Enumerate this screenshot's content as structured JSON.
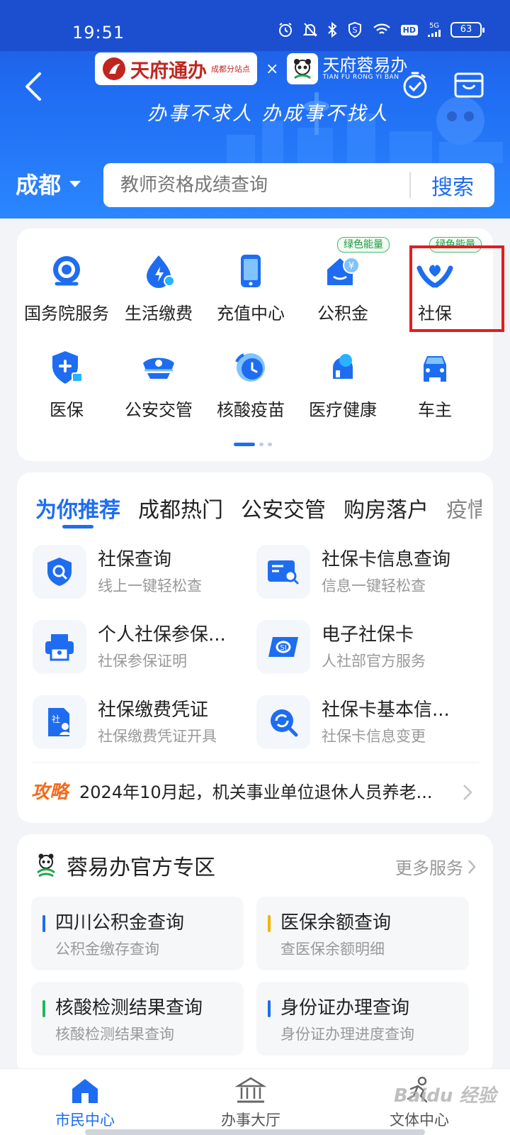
{
  "status_bar": {
    "time": "19:51",
    "signal": "5G",
    "hd": "HD",
    "battery": "63"
  },
  "header": {
    "brand_name": "天府通办",
    "brand_sub": "成都分站点",
    "separator": "×",
    "partner_name": "天府蓉易办",
    "partner_en": "TIAN FU RONG YI BAN",
    "slogan": "办事不求人 办成事不找人"
  },
  "location": {
    "city": "成都"
  },
  "search": {
    "placeholder": "教师资格成绩查询",
    "button_label": "搜索"
  },
  "grid": {
    "items": [
      {
        "label": "国务院服务",
        "icon": "state-council-icon"
      },
      {
        "label": "生活缴费",
        "icon": "utility-payment-icon"
      },
      {
        "label": "充值中心",
        "icon": "recharge-icon"
      },
      {
        "label": "公积金",
        "icon": "housing-fund-icon",
        "badge": "绿色能量"
      },
      {
        "label": "社保",
        "icon": "social-security-icon",
        "badge": "绿色能量",
        "highlighted": true
      },
      {
        "label": "医保",
        "icon": "medical-insurance-icon"
      },
      {
        "label": "公安交管",
        "icon": "police-cap-icon"
      },
      {
        "label": "核酸疫苗",
        "icon": "vaccine-clock-icon"
      },
      {
        "label": "医疗健康",
        "icon": "health-icon"
      },
      {
        "label": "车主",
        "icon": "car-icon"
      }
    ],
    "page": 1,
    "page_count": 3
  },
  "recommend": {
    "tabs": [
      "为你推荐",
      "成都热门",
      "公安交管",
      "购房落户",
      "疫情"
    ],
    "active_tab": 0,
    "items": [
      {
        "title": "社保查询",
        "subtitle": "线上一键轻松查",
        "icon": "shield-search-icon"
      },
      {
        "title": "社保卡信息查询",
        "subtitle": "信息一键轻松查",
        "icon": "card-search-icon"
      },
      {
        "title": "个人社保参保...",
        "subtitle": "社保参保证明",
        "icon": "printer-icon"
      },
      {
        "title": "电子社保卡",
        "subtitle": "人社部官方服务",
        "icon": "social-card-icon"
      },
      {
        "title": "社保缴费凭证",
        "subtitle": "社保缴费凭证开具",
        "icon": "document-person-icon"
      },
      {
        "title": "社保卡基本信...",
        "subtitle": "社保卡信息变更",
        "icon": "refresh-search-icon"
      }
    ],
    "strategy": {
      "tag": "攻略",
      "text": "2024年10月起，机关事业单位退休人员养老..."
    }
  },
  "official_zone": {
    "title": "蓉易办官方专区",
    "more": "更多服务",
    "items": [
      {
        "title": "四川公积金查询",
        "subtitle": "公积金缴存查询",
        "accent": "#1e6df0"
      },
      {
        "title": "医保余额查询",
        "subtitle": "查医保余额明细",
        "accent": "#f0b400"
      },
      {
        "title": "核酸检测结果查询",
        "subtitle": "核酸检测结果查询",
        "accent": "#21b65b"
      },
      {
        "title": "身份证办理查询",
        "subtitle": "身份证办理进度查询",
        "accent": "#1e6df0"
      }
    ]
  },
  "bottom_nav": {
    "items": [
      {
        "label": "市民中心",
        "active": true
      },
      {
        "label": "办事大厅",
        "active": false
      },
      {
        "label": "文体中心",
        "active": false
      }
    ]
  },
  "watermark": "Baidu 经验",
  "colors": {
    "primary": "#1e6df0",
    "highlight": "#e31d1d",
    "energy": "#1b9a3c",
    "strategy": "#f26a1b"
  }
}
